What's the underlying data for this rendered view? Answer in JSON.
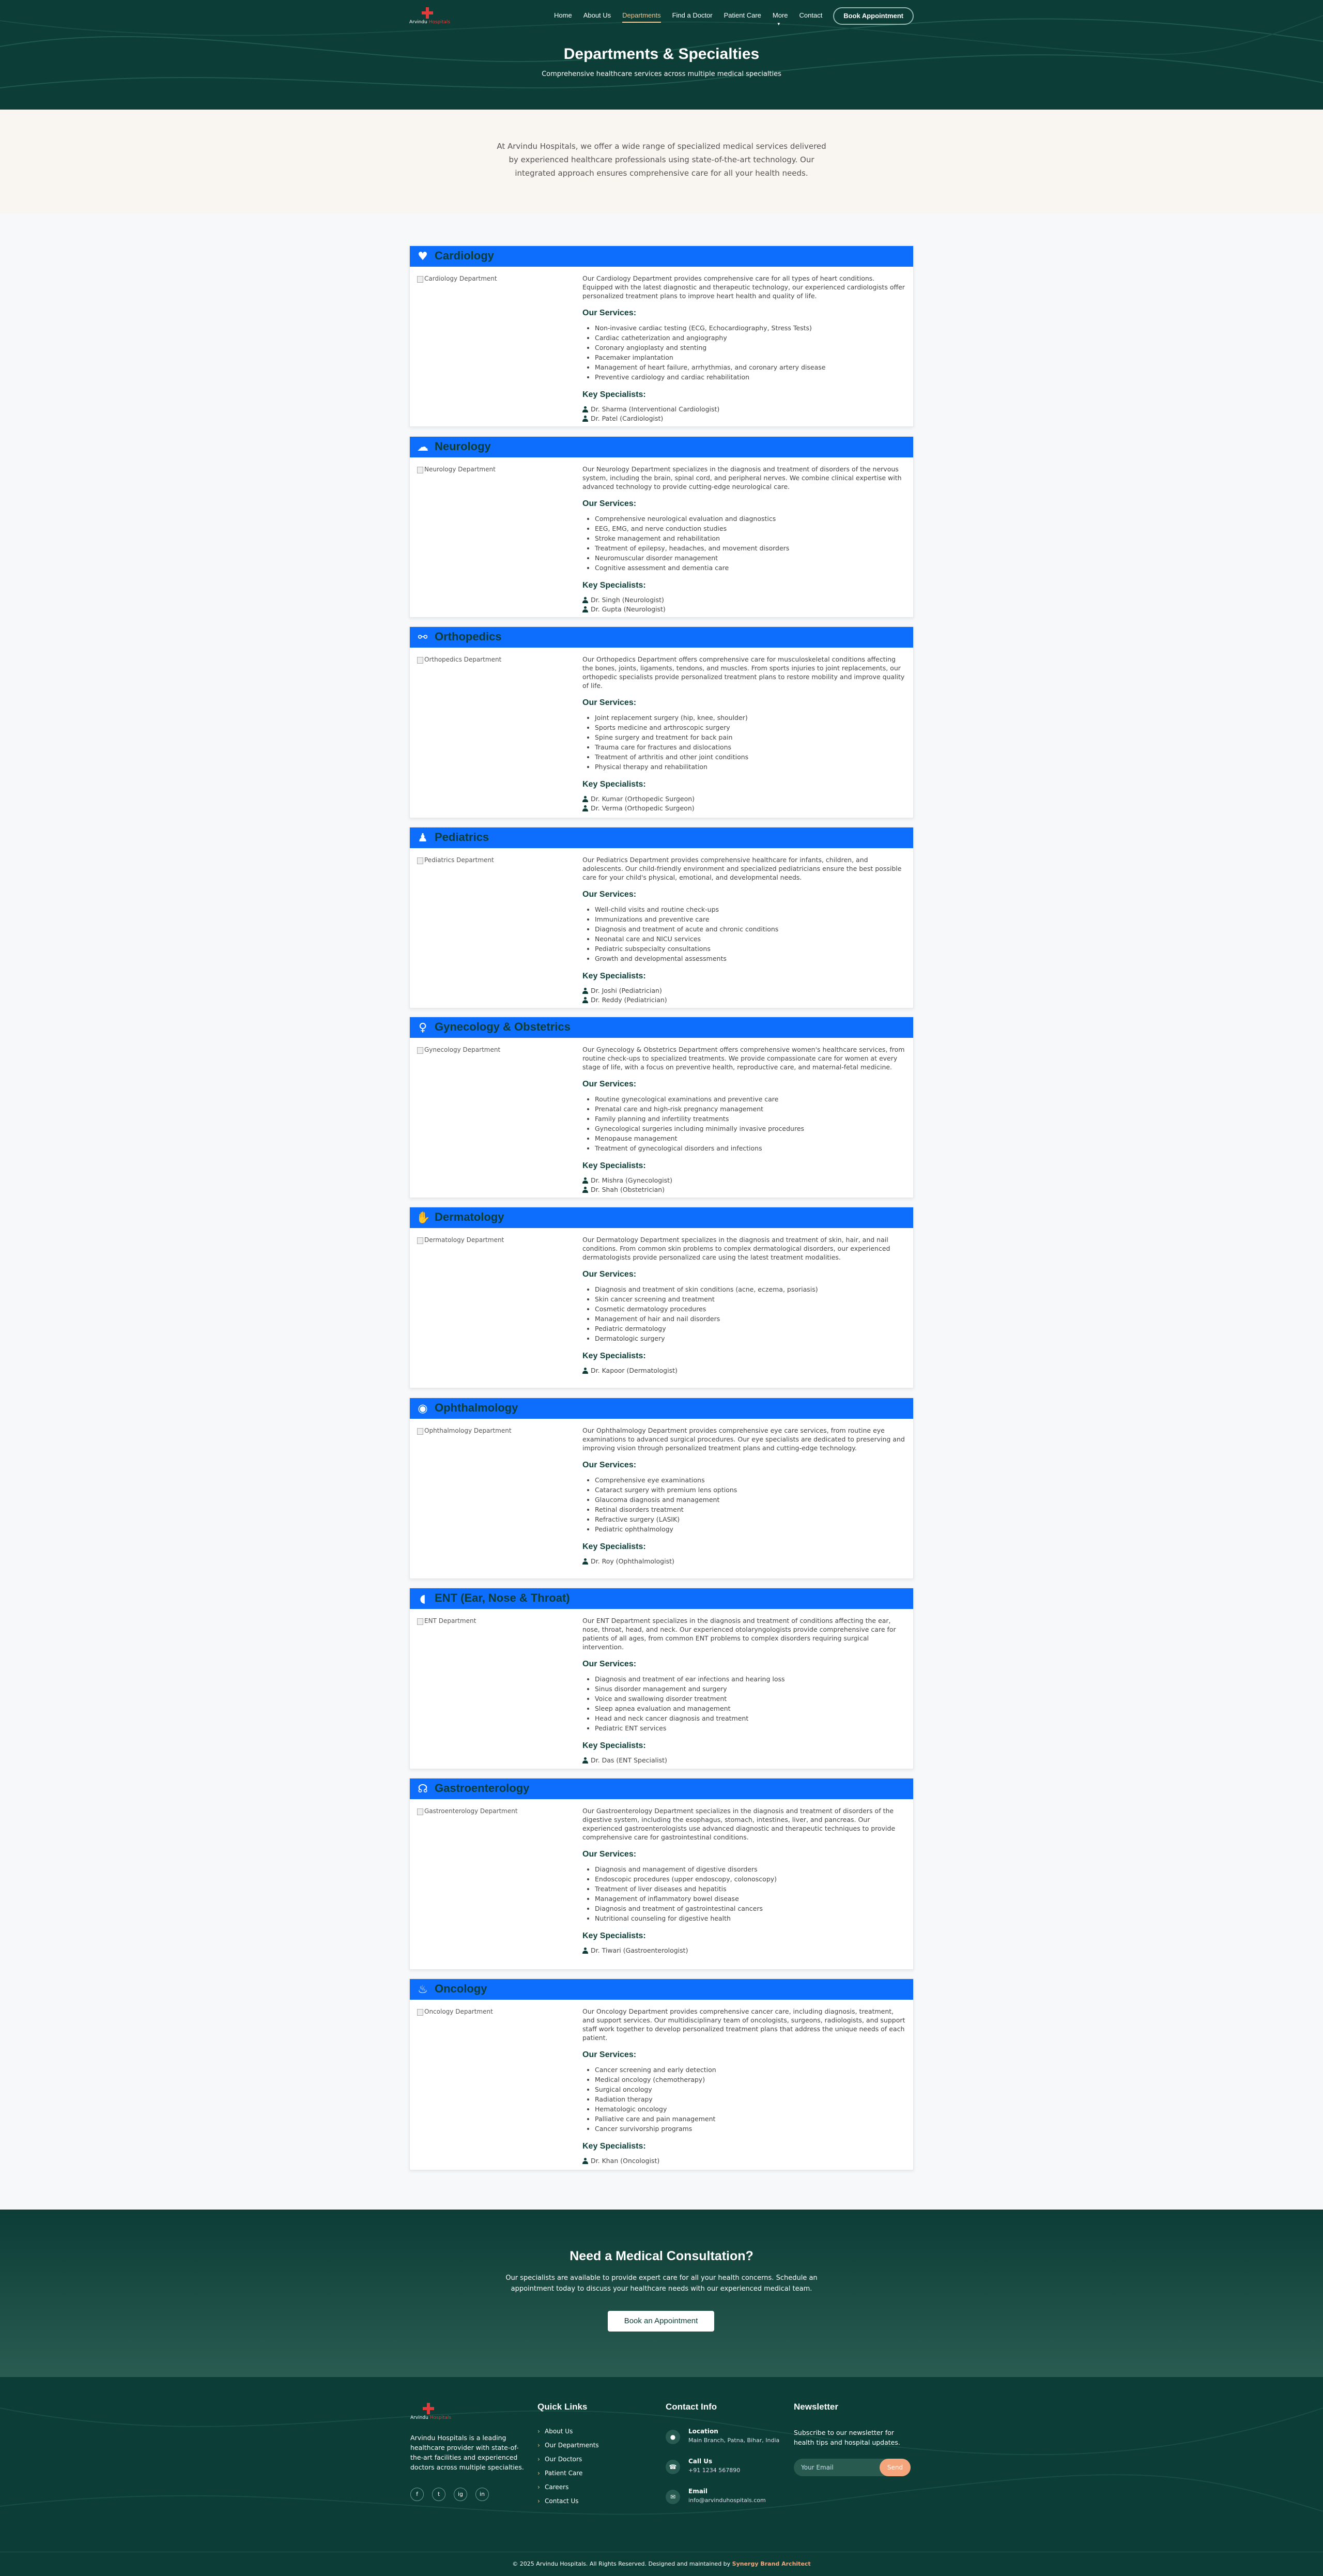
{
  "brand": {
    "name_a": "Arvindu",
    "name_b": "Hospitals"
  },
  "nav": {
    "items": [
      {
        "label": "Home"
      },
      {
        "label": "About Us"
      },
      {
        "label": "Departments",
        "active": true
      },
      {
        "label": "Find a Doctor"
      },
      {
        "label": "Patient Care"
      },
      {
        "label": "More"
      },
      {
        "label": "Contact"
      }
    ],
    "cta": "Book Appointment"
  },
  "hero": {
    "title": "Departments & Specialties",
    "subtitle": "Comprehensive healthcare services across multiple medical specialties"
  },
  "intro": "At Arvindu Hospitals, we offer a wide range of specialized medical services delivered by experienced healthcare professionals using state-of-the-art technology. Our integrated approach ensures comprehensive care for all your health needs.",
  "labels": {
    "services": "Our Services:",
    "specialists": "Key Specialists:"
  },
  "departments": [
    {
      "name": "Cardiology",
      "icon": "heart-pulse-icon",
      "img_alt": "Cardiology Department",
      "description": "Our Cardiology Department provides comprehensive care for all types of heart conditions. Equipped with the latest diagnostic and therapeutic technology, our experienced cardiologists offer personalized treatment plans to improve heart health and quality of life.",
      "services": [
        "Non-invasive cardiac testing (ECG, Echocardiography, Stress Tests)",
        "Cardiac catheterization and angiography",
        "Coronary angioplasty and stenting",
        "Pacemaker implantation",
        "Management of heart failure, arrhythmias, and coronary artery disease",
        "Preventive cardiology and cardiac rehabilitation"
      ],
      "specialists": [
        "Dr. Sharma (Interventional Cardiologist)",
        "Dr. Patel (Cardiologist)"
      ]
    },
    {
      "name": "Neurology",
      "icon": "brain-icon",
      "img_alt": "Neurology Department",
      "description": "Our Neurology Department specializes in the diagnosis and treatment of disorders of the nervous system, including the brain, spinal cord, and peripheral nerves. We combine clinical expertise with advanced technology to provide cutting-edge neurological care.",
      "services": [
        "Comprehensive neurological evaluation and diagnostics",
        "EEG, EMG, and nerve conduction studies",
        "Stroke management and rehabilitation",
        "Treatment of epilepsy, headaches, and movement disorders",
        "Neuromuscular disorder management",
        "Cognitive assessment and dementia care"
      ],
      "specialists": [
        "Dr. Singh (Neurologist)",
        "Dr. Gupta (Neurologist)"
      ]
    },
    {
      "name": "Orthopedics",
      "icon": "bone-icon",
      "img_alt": "Orthopedics Department",
      "description": "Our Orthopedics Department offers comprehensive care for musculoskeletal conditions affecting the bones, joints, ligaments, tendons, and muscles. From sports injuries to joint replacements, our orthopedic specialists provide personalized treatment plans to restore mobility and improve quality of life.",
      "services": [
        "Joint replacement surgery (hip, knee, shoulder)",
        "Sports medicine and arthroscopic surgery",
        "Spine surgery and treatment for back pain",
        "Trauma care for fractures and dislocations",
        "Treatment of arthritis and other joint conditions",
        "Physical therapy and rehabilitation"
      ],
      "specialists": [
        "Dr. Kumar (Orthopedic Surgeon)",
        "Dr. Verma (Orthopedic Surgeon)"
      ]
    },
    {
      "name": "Pediatrics",
      "icon": "child-icon",
      "img_alt": "Pediatrics Department",
      "description": "Our Pediatrics Department provides comprehensive healthcare for infants, children, and adolescents. Our child-friendly environment and specialized pediatricians ensure the best possible care for your child's physical, emotional, and developmental needs.",
      "services": [
        "Well-child visits and routine check-ups",
        "Immunizations and preventive care",
        "Diagnosis and treatment of acute and chronic conditions",
        "Neonatal care and NICU services",
        "Pediatric subspecialty consultations",
        "Growth and developmental assessments"
      ],
      "specialists": [
        "Dr. Joshi (Pediatrician)",
        "Dr. Reddy (Pediatrician)"
      ]
    },
    {
      "name": "Gynecology & Obstetrics",
      "icon": "female-icon",
      "img_alt": "Gynecology Department",
      "description": "Our Gynecology & Obstetrics Department offers comprehensive women's healthcare services, from routine check-ups to specialized treatments. We provide compassionate care for women at every stage of life, with a focus on preventive health, reproductive care, and maternal-fetal medicine.",
      "services": [
        "Routine gynecological examinations and preventive care",
        "Prenatal care and high-risk pregnancy management",
        "Family planning and infertility treatments",
        "Gynecological surgeries including minimally invasive procedures",
        "Menopause management",
        "Treatment of gynecological disorders and infections"
      ],
      "specialists": [
        "Dr. Mishra (Gynecologist)",
        "Dr. Shah (Obstetrician)"
      ]
    },
    {
      "name": "Dermatology",
      "icon": "hand-icon",
      "img_alt": "Dermatology Department",
      "description": "Our Dermatology Department specializes in the diagnosis and treatment of skin, hair, and nail conditions. From common skin problems to complex dermatological disorders, our experienced dermatologists provide personalized care using the latest treatment modalities.",
      "services": [
        "Diagnosis and treatment of skin conditions (acne, eczema, psoriasis)",
        "Skin cancer screening and treatment",
        "Cosmetic dermatology procedures",
        "Management of hair and nail disorders",
        "Pediatric dermatology",
        "Dermatologic surgery"
      ],
      "specialists": [
        "Dr. Kapoor (Dermatologist)"
      ]
    },
    {
      "name": "Ophthalmology",
      "icon": "eye-icon",
      "img_alt": "Ophthalmology Department",
      "description": "Our Ophthalmology Department provides comprehensive eye care services, from routine eye examinations to advanced surgical procedures. Our eye specialists are dedicated to preserving and improving vision through personalized treatment plans and cutting-edge technology.",
      "services": [
        "Comprehensive eye examinations",
        "Cataract surgery with premium lens options",
        "Glaucoma diagnosis and management",
        "Retinal disorders treatment",
        "Refractive surgery (LASIK)",
        "Pediatric ophthalmology"
      ],
      "specialists": [
        "Dr. Roy (Ophthalmologist)"
      ]
    },
    {
      "name": "ENT (Ear, Nose & Throat)",
      "icon": "ear-icon",
      "img_alt": "ENT Department",
      "description": "Our ENT Department specializes in the diagnosis and treatment of conditions affecting the ear, nose, throat, head, and neck. Our experienced otolaryngologists provide comprehensive care for patients of all ages, from common ENT problems to complex disorders requiring surgical intervention.",
      "services": [
        "Diagnosis and treatment of ear infections and hearing loss",
        "Sinus disorder management and surgery",
        "Voice and swallowing disorder treatment",
        "Sleep apnea evaluation and management",
        "Head and neck cancer diagnosis and treatment",
        "Pediatric ENT services"
      ],
      "specialists": [
        "Dr. Das (ENT Specialist)"
      ]
    },
    {
      "name": "Gastroenterology",
      "icon": "stomach-icon",
      "img_alt": "Gastroenterology Department",
      "description": "Our Gastroenterology Department specializes in the diagnosis and treatment of disorders of the digestive system, including the esophagus, stomach, intestines, liver, and pancreas. Our experienced gastroenterologists use advanced diagnostic and therapeutic techniques to provide comprehensive care for gastrointestinal conditions.",
      "services": [
        "Diagnosis and management of digestive disorders",
        "Endoscopic procedures (upper endoscopy, colonoscopy)",
        "Treatment of liver diseases and hepatitis",
        "Management of inflammatory bowel disease",
        "Diagnosis and treatment of gastrointestinal cancers",
        "Nutritional counseling for digestive health"
      ],
      "specialists": [
        "Dr. Tiwari (Gastroenterologist)"
      ]
    },
    {
      "name": "Oncology",
      "icon": "ribbon-icon",
      "img_alt": "Oncology Department",
      "description": "Our Oncology Department provides comprehensive cancer care, including diagnosis, treatment, and support services. Our multidisciplinary team of oncologists, surgeons, radiologists, and support staff work together to develop personalized treatment plans that address the unique needs of each patient.",
      "services": [
        "Cancer screening and early detection",
        "Medical oncology (chemotherapy)",
        "Surgical oncology",
        "Radiation therapy",
        "Hematologic oncology",
        "Palliative care and pain management",
        "Cancer survivorship programs"
      ],
      "specialists": [
        "Dr. Khan (Oncologist)"
      ]
    }
  ],
  "cta": {
    "title": "Need a Medical Consultation?",
    "text": "Our specialists are available to provide expert care for all your health concerns. Schedule an appointment today to discuss your healthcare needs with our experienced medical team.",
    "button": "Book an Appointment"
  },
  "footer": {
    "about": "Arvindu Hospitals is a leading healthcare provider with state-of-the-art facilities and experienced doctors across multiple specialties.",
    "social": [
      "f",
      "t",
      "ig",
      "in"
    ],
    "quick_title": "Quick Links",
    "quick_links": [
      "About Us",
      "Our Departments",
      "Our Doctors",
      "Patient Care",
      "Careers",
      "Contact Us"
    ],
    "contact_title": "Contact Info",
    "contact": [
      {
        "label": "Location",
        "value": "Main Branch, Patna, Bihar, India",
        "icon": "map-pin-icon"
      },
      {
        "label": "Call Us",
        "value": "+91 1234 567890",
        "icon": "phone-icon"
      },
      {
        "label": "Email",
        "value": "info@arvinduhospitals.com",
        "icon": "mail-icon"
      }
    ],
    "news_title": "Newsletter",
    "news_text": "Subscribe to our newsletter for health tips and hospital updates.",
    "news_placeholder": "Your Email",
    "news_button": "Send",
    "copyright": "© 2025 Arvindu Hospitals. All Rights Reserved. Designed and maintained by",
    "designer": "Synergy Brand Architect"
  }
}
